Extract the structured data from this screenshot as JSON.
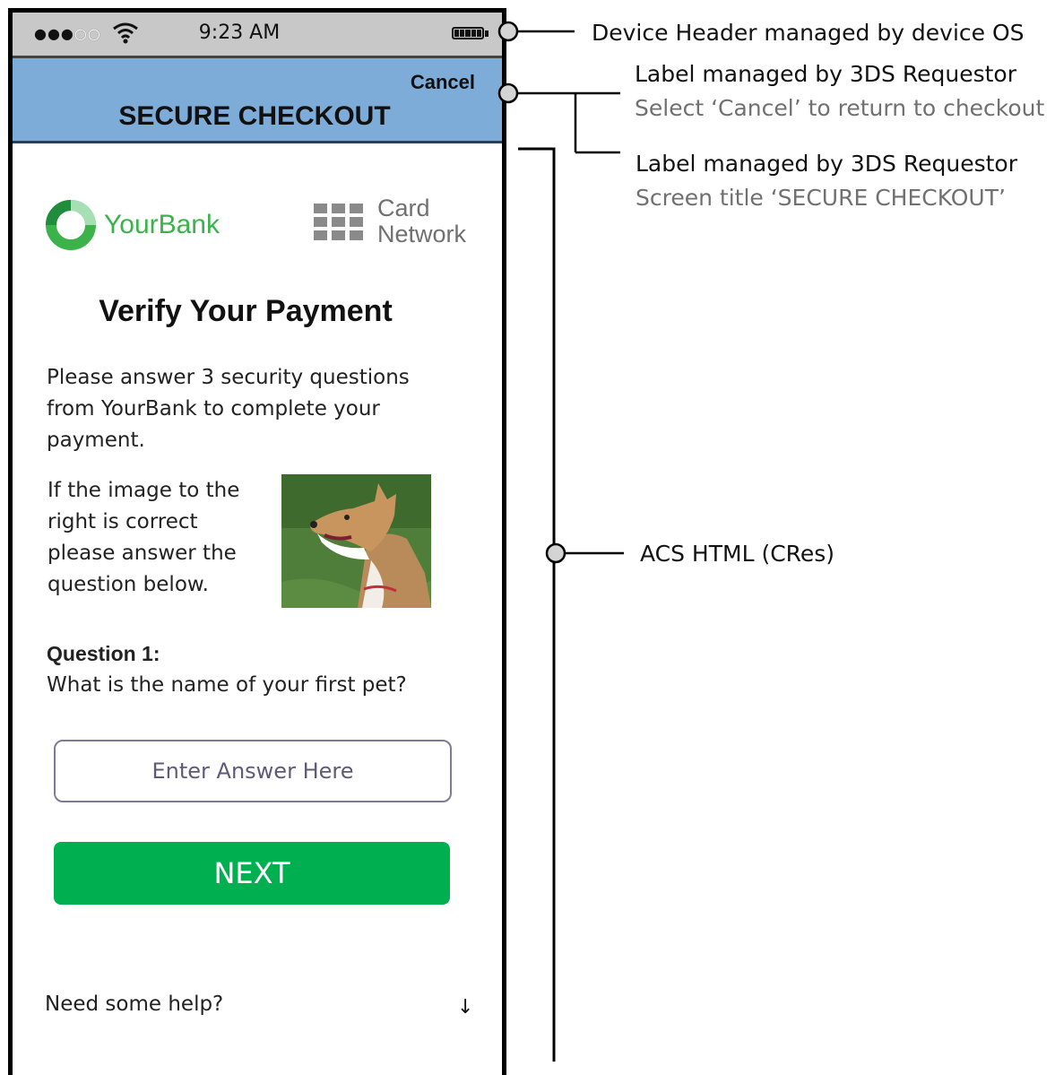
{
  "status_bar": {
    "signal_dots": "●●●",
    "signal_dots_dim": "○○",
    "time": "9:23 AM"
  },
  "nav": {
    "cancel_label": "Cancel",
    "screen_title": "SECURE CHECKOUT"
  },
  "logos": {
    "bank_name": "YourBank",
    "network_line1": "Card",
    "network_line2": "Network"
  },
  "content": {
    "heading": "Verify Your Payment",
    "intro": "Please answer 3 security questions from YourBank to complete your payment.",
    "image_prompt": "If the image to the right is correct please answer the question below.",
    "question_label": "Question 1:",
    "question_text": "What is the name of your first pet?",
    "answer_placeholder": "Enter Answer Here",
    "next_label": "NEXT",
    "help_text": "Need some help?",
    "help_arrow": "↓"
  },
  "annotations": {
    "device_header": "Device Header managed by device OS",
    "cancel_label_title": "Label managed by 3DS Requestor",
    "cancel_label_desc": "Select ‘Cancel’ to return to checkout",
    "screen_title_title": "Label managed by 3DS Requestor",
    "screen_title_desc": "Screen title ‘SECURE CHECKOUT’",
    "acs_html": "ACS HTML (CRes)"
  },
  "colors": {
    "nav_bar": "#7eacd8",
    "status_bar": "#c8c8c8",
    "bank_green": "#3bb24a",
    "next_button": "#00af50"
  }
}
